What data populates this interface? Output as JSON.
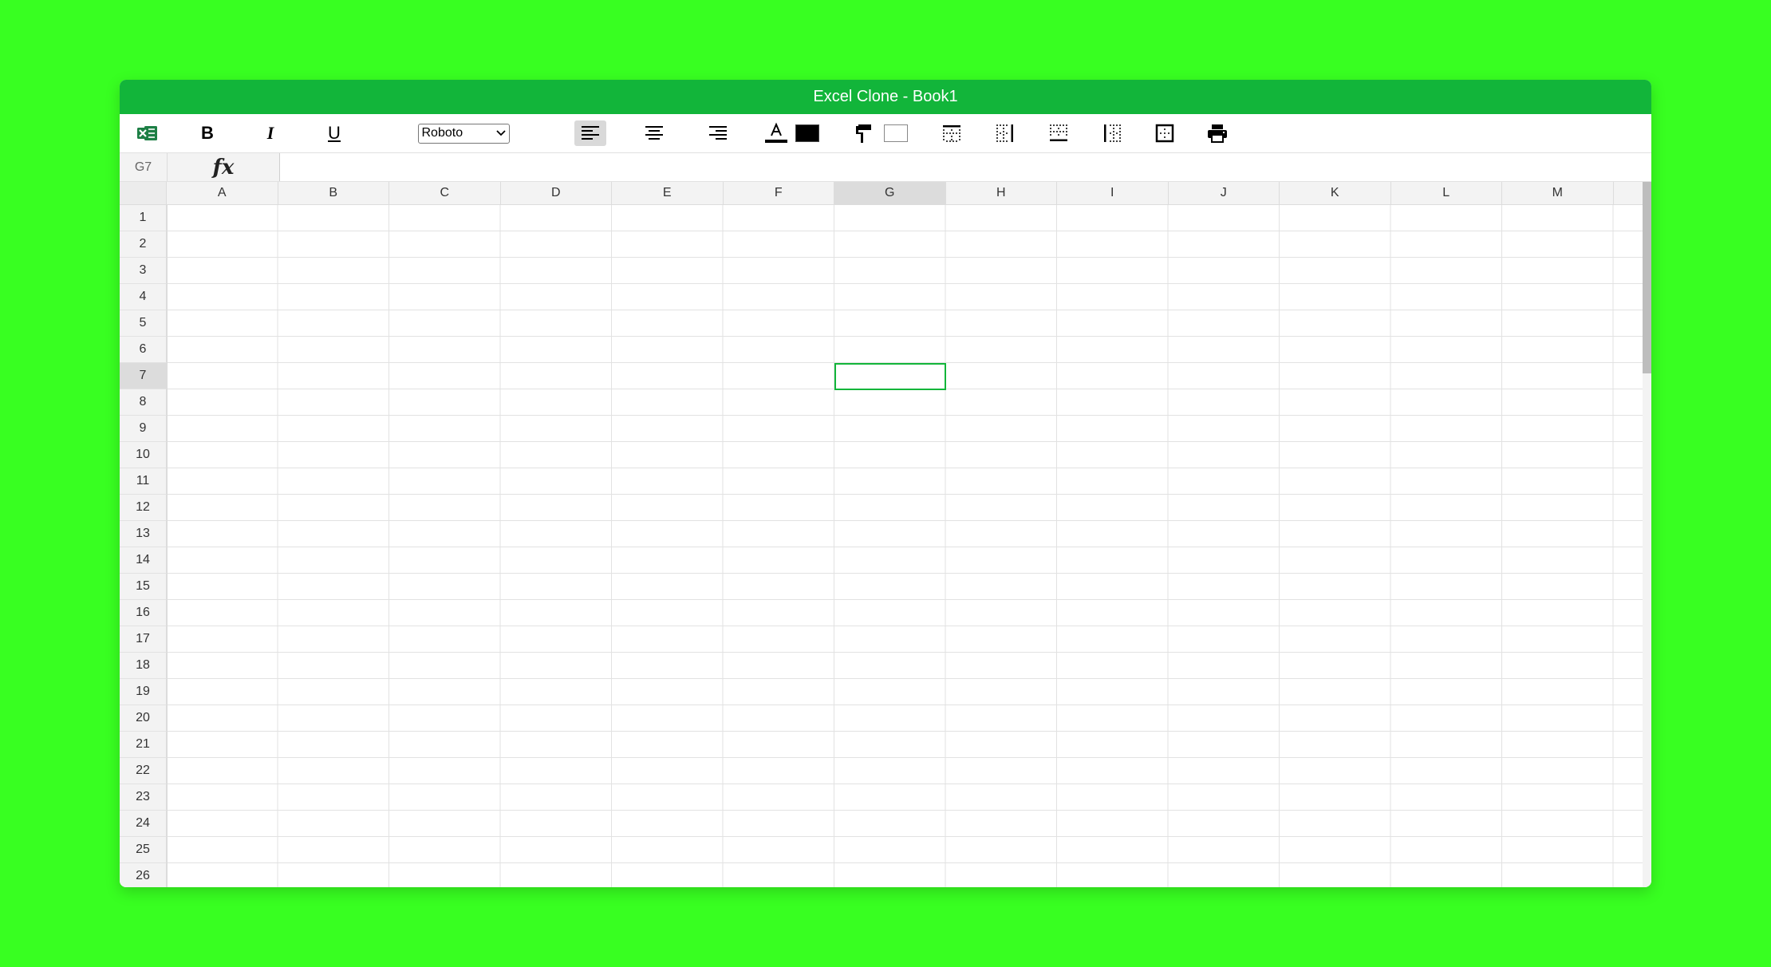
{
  "window": {
    "title": "Excel Clone - Book1"
  },
  "toolbar": {
    "bold_label": "B",
    "italic_label": "I",
    "underline_label": "U",
    "font_family": {
      "selected": "Roboto"
    },
    "text_color": "#000000",
    "fill_color": "#ffffff",
    "align_active": "left",
    "brand_color": "#12b53a"
  },
  "formula_bar": {
    "cell_reference": "G7",
    "fx_label": "fx",
    "formula_value": ""
  },
  "sheet": {
    "columns": [
      "A",
      "B",
      "C",
      "D",
      "E",
      "F",
      "G",
      "H",
      "I",
      "J",
      "K",
      "L",
      "M"
    ],
    "rows": [
      "1",
      "2",
      "3",
      "4",
      "5",
      "6",
      "7",
      "8",
      "9",
      "10",
      "11",
      "12",
      "13",
      "14",
      "15",
      "16",
      "17",
      "18",
      "19",
      "20",
      "21",
      "22",
      "23",
      "24",
      "25",
      "26"
    ],
    "active_cell": {
      "column": "G",
      "row": "7"
    }
  }
}
